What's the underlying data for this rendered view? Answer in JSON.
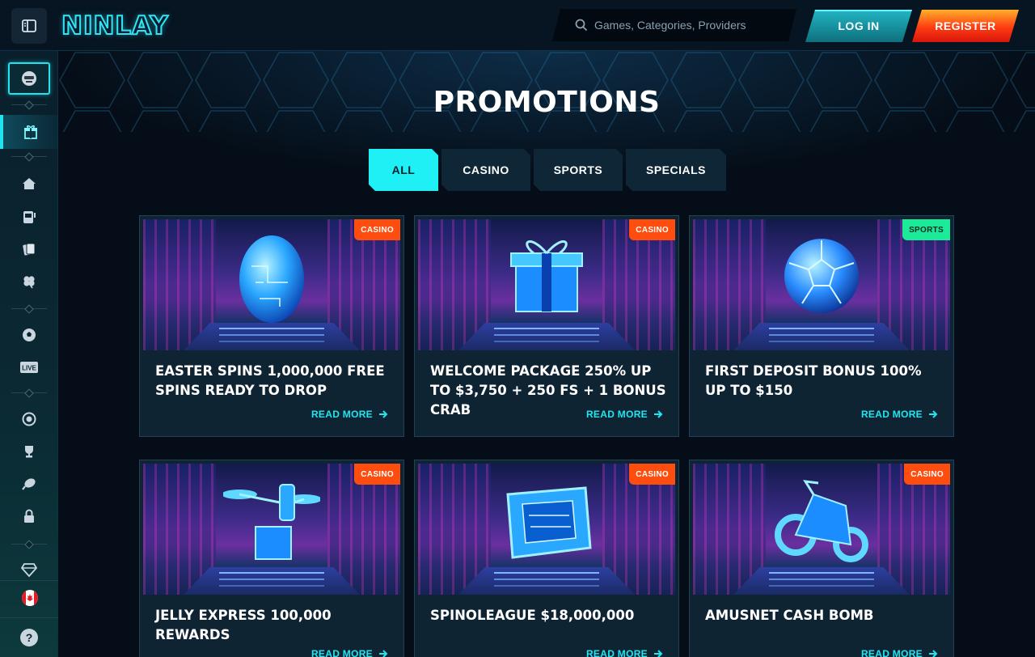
{
  "header": {
    "logo": "NINLAY",
    "search_placeholder": "Games, Categories, Providers",
    "login_label": "LOG IN",
    "register_label": "REGISTER"
  },
  "sidebar": {
    "items": [
      {
        "name": "gift-icon"
      },
      {
        "name": "home-icon"
      },
      {
        "name": "slot-machine-icon"
      },
      {
        "name": "cards-icon"
      },
      {
        "name": "clover-icon"
      },
      {
        "name": "soccer-ball-icon"
      },
      {
        "name": "live-icon",
        "label": "LIVE"
      },
      {
        "name": "badge-icon"
      },
      {
        "name": "trophy-icon"
      },
      {
        "name": "racket-icon"
      },
      {
        "name": "lock-icon"
      },
      {
        "name": "diamond-icon"
      }
    ],
    "help_label": "?"
  },
  "main": {
    "title": "PROMOTIONS",
    "tabs": [
      {
        "label": "ALL",
        "active": true
      },
      {
        "label": "CASINO",
        "active": false
      },
      {
        "label": "SPORTS",
        "active": false
      },
      {
        "label": "SPECIALS",
        "active": false
      }
    ],
    "read_more_label": "READ MORE",
    "cards": [
      {
        "title": "EASTER SPINS 1,000,000 FREE SPINS READY TO DROP",
        "badge": "CASINO",
        "icon": "egg-icon"
      },
      {
        "title": "WELCOME PACKAGE 250% UP TO $3,750 + 250 FS + 1 BONUS CRAB",
        "badge": "CASINO",
        "icon": "gift-box-icon"
      },
      {
        "title": "FIRST DEPOSIT BONUS 100% UP TO $150",
        "badge": "SPORTS",
        "icon": "soccer-ball-icon"
      },
      {
        "title": "JELLY EXPRESS 100,000 REWARDS",
        "badge": "CASINO",
        "icon": "drone-icon"
      },
      {
        "title": "SPINOLEAGUE $18,000,000",
        "badge": "CASINO",
        "icon": "console-icon"
      },
      {
        "title": "AMUSNET CASH BOMB",
        "badge": "CASINO",
        "icon": "motorcycle-icon"
      }
    ]
  },
  "colors": {
    "accent": "#1ff0f6",
    "casino_badge": "#ff4d0f",
    "sports_badge": "#1bea98",
    "register": "#ff3b12",
    "login": "#23b6c4"
  }
}
